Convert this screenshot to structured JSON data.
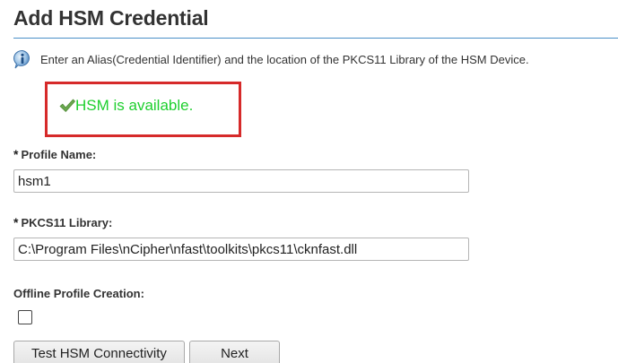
{
  "title": "Add HSM Credential",
  "info": {
    "icon": "info-icon",
    "text": "Enter an Alias(Credential Identifier) and the location of the PKCS11 Library of the HSM Device."
  },
  "status": {
    "icon": "checkmark-icon",
    "text": "HSM is available.",
    "color": "#1ecf2e",
    "highlight_color": "#d62a2a"
  },
  "fields": {
    "required_marker": "*",
    "profile_name": {
      "label": "Profile Name:",
      "value": "hsm1"
    },
    "pkcs11_library": {
      "label": "PKCS11 Library:",
      "value": "C:\\Program Files\\nCipher\\nfast\\toolkits\\pkcs11\\cknfast.dll"
    },
    "offline_profile": {
      "label": "Offline Profile Creation:",
      "checked": false
    }
  },
  "buttons": {
    "test_label": "Test HSM Connectivity",
    "next_label": "Next"
  },
  "colors": {
    "title_rule": "#4a90c8"
  }
}
